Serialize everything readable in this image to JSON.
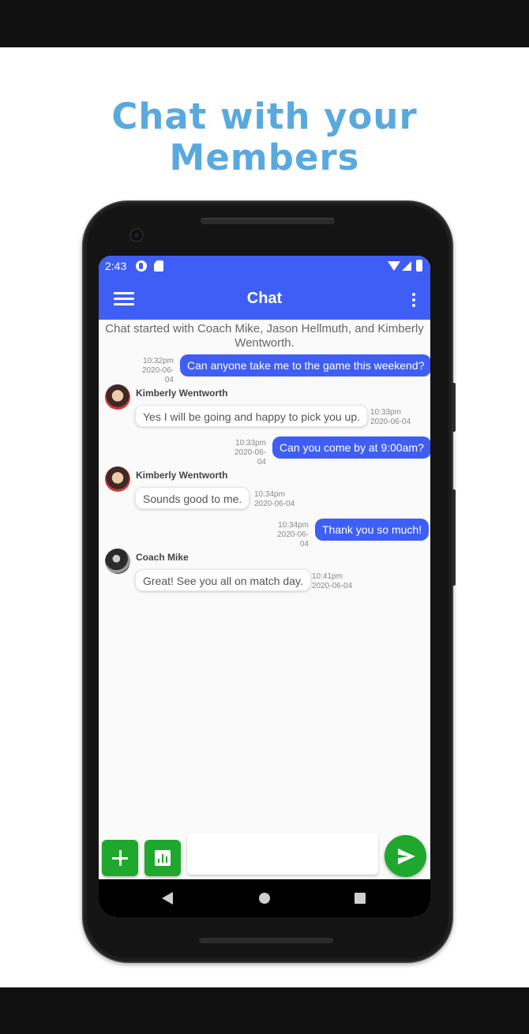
{
  "promo": {
    "headline_line1": "Chat with your",
    "headline_line2": "Members"
  },
  "statusbar": {
    "time": "2:43"
  },
  "appbar": {
    "title": "Chat",
    "menu_icon": "hamburger-menu-icon",
    "more_icon": "more-vert-icon"
  },
  "chat": {
    "notice": "Chat started with Coach Mike, Jason Hellmuth, and Kimberly Wentworth.",
    "messages": [
      {
        "direction": "out",
        "text": "Can anyone take me to the game this weekend?",
        "time": "10:32pm",
        "date": "2020-06-04"
      },
      {
        "direction": "in",
        "sender": "Kimberly Wentworth",
        "text": "Yes I will be going and happy to pick you up.",
        "time": "10:33pm",
        "date": "2020-06-04"
      },
      {
        "direction": "out",
        "text": "Can you come by at 9:00am?",
        "time": "10:33pm",
        "date": "2020-06-04"
      },
      {
        "direction": "in",
        "sender": "Kimberly Wentworth",
        "text": "Sounds good to me.",
        "time": "10:34pm",
        "date": "2020-06-04"
      },
      {
        "direction": "out",
        "text": "Thank you so much!",
        "time": "10:34pm",
        "date": "2020-06-04"
      },
      {
        "direction": "in",
        "sender": "Coach Mike",
        "text": "Great! See you all on match day.",
        "time": "10:41pm",
        "date": "2020-06-04"
      }
    ]
  },
  "composer": {
    "placeholder": "",
    "add_icon": "plus-icon",
    "poll_icon": "bar-chart-icon",
    "send_icon": "send-icon"
  },
  "colors": {
    "primary": "#3f5ef5",
    "accent": "#1fa82d",
    "headline": "#5aa9de"
  }
}
